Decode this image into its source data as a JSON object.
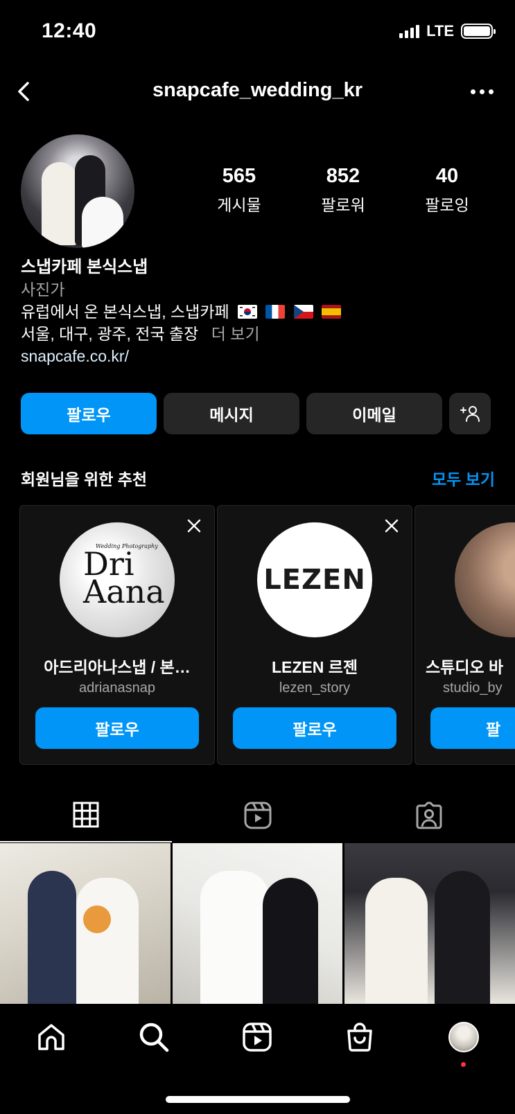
{
  "status_bar": {
    "time": "12:40",
    "network": "LTE"
  },
  "header": {
    "username": "snapcafe_wedding_kr",
    "back_icon": "chevron-left-icon",
    "more_icon": "more-horizontal-icon"
  },
  "stats": [
    {
      "value": "565",
      "label": "게시물"
    },
    {
      "value": "852",
      "label": "팔로워"
    },
    {
      "value": "40",
      "label": "팔로잉"
    }
  ],
  "bio": {
    "name": "스냅카페 본식스냅",
    "category": "사진가",
    "line1": "유럽에서 온 본식스냅, 스냅카페",
    "flags": [
      "south-korea-flag",
      "france-flag",
      "czech-flag",
      "spain-flag"
    ],
    "line2": "서울, 대구, 광주, 전국 출장",
    "more": "더 보기",
    "link": "snapcafe.co.kr/"
  },
  "actions": {
    "follow": "팔로우",
    "message": "메시지",
    "email": "이메일",
    "add_user_icon": "add-person-icon"
  },
  "suggestions": {
    "title": "회원님을 위한 추천",
    "see_all": "모두 보기",
    "cards": [
      {
        "name": "아드리아나스냅 / 본…",
        "handle": "adrianasnap",
        "follow": "팔로우",
        "logo_text": "Dri Aana",
        "logo_sub": "Wedding Photography"
      },
      {
        "name": "LEZEN 르젠",
        "handle": "lezen_story",
        "follow": "팔로우",
        "logo_text": "LEZEN"
      },
      {
        "name": "스튜디오 바",
        "handle": "studio_by",
        "follow": "팔"
      }
    ]
  },
  "tabs": [
    {
      "icon": "grid-icon",
      "active": true
    },
    {
      "icon": "reels-icon",
      "active": false
    },
    {
      "icon": "tagged-icon",
      "active": false
    }
  ],
  "bottom_nav": [
    "home-icon",
    "search-icon",
    "reels-icon",
    "shop-icon",
    "profile-avatar"
  ],
  "colors": {
    "accent": "#0095f6",
    "background": "#000000",
    "button_secondary": "#262626",
    "notification_dot": "#ff3040"
  }
}
